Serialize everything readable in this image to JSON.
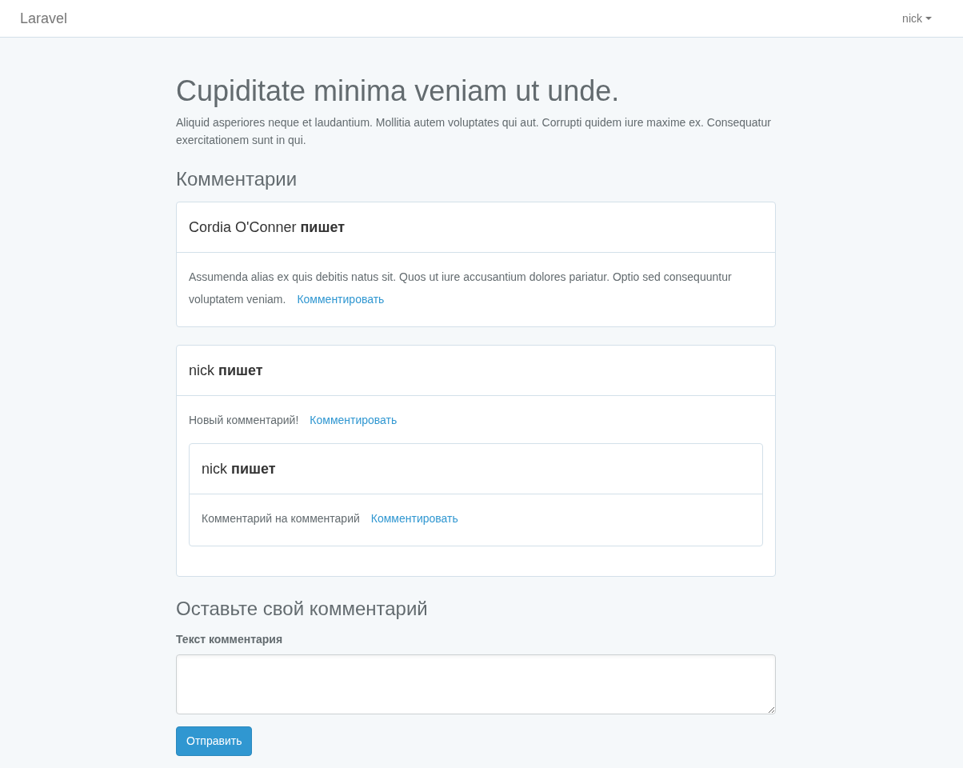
{
  "navbar": {
    "brand": "Laravel",
    "user_menu": "nick"
  },
  "post": {
    "title": "Cupiditate minima veniam ut unde.",
    "body": "Aliquid asperiores neque et laudantium. Mollitia autem voluptates qui aut. Corrupti quidem iure maxime ex. Consequatur exercitationem sunt in qui."
  },
  "comments_heading": "Комментарии",
  "comments": [
    {
      "header": "Cordia O'Conner **пишет**",
      "text": "Assumenda alias ex quis debitis natus sit. Quos ut iure accusantium dolores pariatur. Optio sed consequuntur voluptatem veniam.",
      "reply_link": "Комментировать"
    },
    {
      "header": "nick **пишет**",
      "text": "Новый комментарий!",
      "reply_link": "Комментировать",
      "children": [
        {
          "header": "nick **пишет**",
          "text": "Комментарий на комментарий",
          "reply_link": "Комментировать"
        }
      ]
    }
  ],
  "form": {
    "heading": "Оставьте свой комментарий",
    "label": "Текст комментария",
    "submit": "Отправить"
  }
}
